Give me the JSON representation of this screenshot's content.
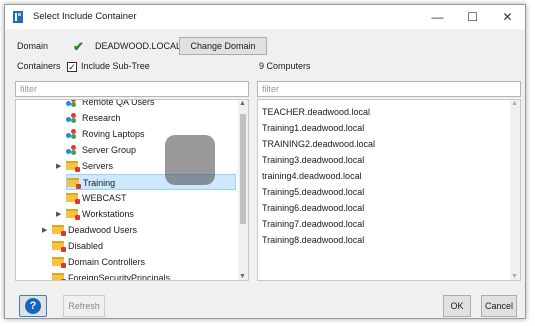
{
  "window": {
    "title": "Select Include Container",
    "minimize_label": "—",
    "maximize_label": "☐",
    "close_label": "✕"
  },
  "domain": {
    "label": "Domain",
    "value": "DEADWOOD.LOCAL",
    "change_button": "Change Domain",
    "status_icon": "checkmark-icon"
  },
  "containers": {
    "label": "Containers",
    "subtree_label": "Include Sub-Tree",
    "subtree_checked": true,
    "filter_placeholder": "filter",
    "items": [
      {
        "label": "Remote QA Users",
        "type": "ou"
      },
      {
        "label": "Research",
        "type": "ou"
      },
      {
        "label": "Roving Laptops",
        "type": "ou"
      },
      {
        "label": "Server Group",
        "type": "ou"
      },
      {
        "label": "Servers",
        "type": "folder"
      },
      {
        "label": "Training",
        "type": "folder"
      },
      {
        "label": "WEBCAST",
        "type": "folder"
      },
      {
        "label": "Workstations",
        "type": "folder"
      },
      {
        "label": "Deadwood Users",
        "type": "folder"
      },
      {
        "label": "Disabled",
        "type": "folder"
      },
      {
        "label": "Domain Controllers",
        "type": "folder"
      },
      {
        "label": "ForeignSecurityPrincipals",
        "type": "folder"
      }
    ]
  },
  "computers": {
    "count_label": "9 Computers",
    "filter_placeholder": "filter",
    "items": [
      "TEACHER.deadwood.local",
      "Training1.deadwood.local",
      "TRAINING2.deadwood.local",
      "Training3.deadwood.local",
      "training4.deadwood.local",
      "Training5.deadwood.local",
      "Training6.deadwood.local",
      "Training7.deadwood.local",
      "Training8.deadwood.local"
    ]
  },
  "footer": {
    "help_label": "?",
    "refresh_label": "Refresh",
    "ok_label": "OK",
    "cancel_label": "Cancel"
  }
}
